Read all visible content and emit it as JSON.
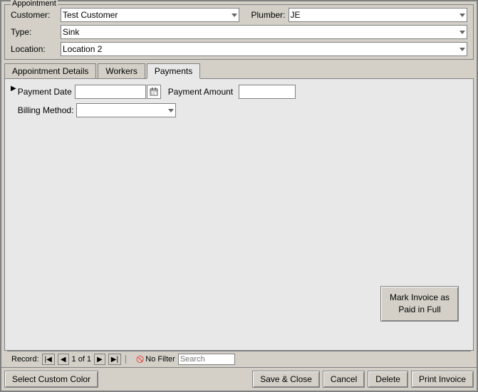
{
  "window": {
    "title": "Appointment"
  },
  "fields": {
    "customer_label": "Customer:",
    "customer_value": "Test Customer",
    "plumber_label": "Plumber:",
    "plumber_value": "JE",
    "type_label": "Type:",
    "type_value": "Sink",
    "location_label": "Location:",
    "location_value": "Location 2"
  },
  "tabs": {
    "appointment_details": "Appointment Details",
    "workers": "Workers",
    "payments": "Payments"
  },
  "payments": {
    "payment_date_label": "Payment Date",
    "payment_date_value": "",
    "payment_amount_label": "Payment Amount",
    "payment_amount_value": "",
    "billing_method_label": "Billing Method:",
    "billing_method_value": ""
  },
  "mark_invoice_button": "Mark Invoice as Paid in Full",
  "record_nav": {
    "label": "Record:",
    "record_info": "1 of 1",
    "no_filter": "No Filter",
    "search_placeholder": "Search"
  },
  "bottom_buttons": {
    "select_custom_color": "Select Custom Color",
    "save_close": "Save & Close",
    "cancel": "Cancel",
    "delete": "Delete",
    "print_invoice": "Print Invoice"
  }
}
